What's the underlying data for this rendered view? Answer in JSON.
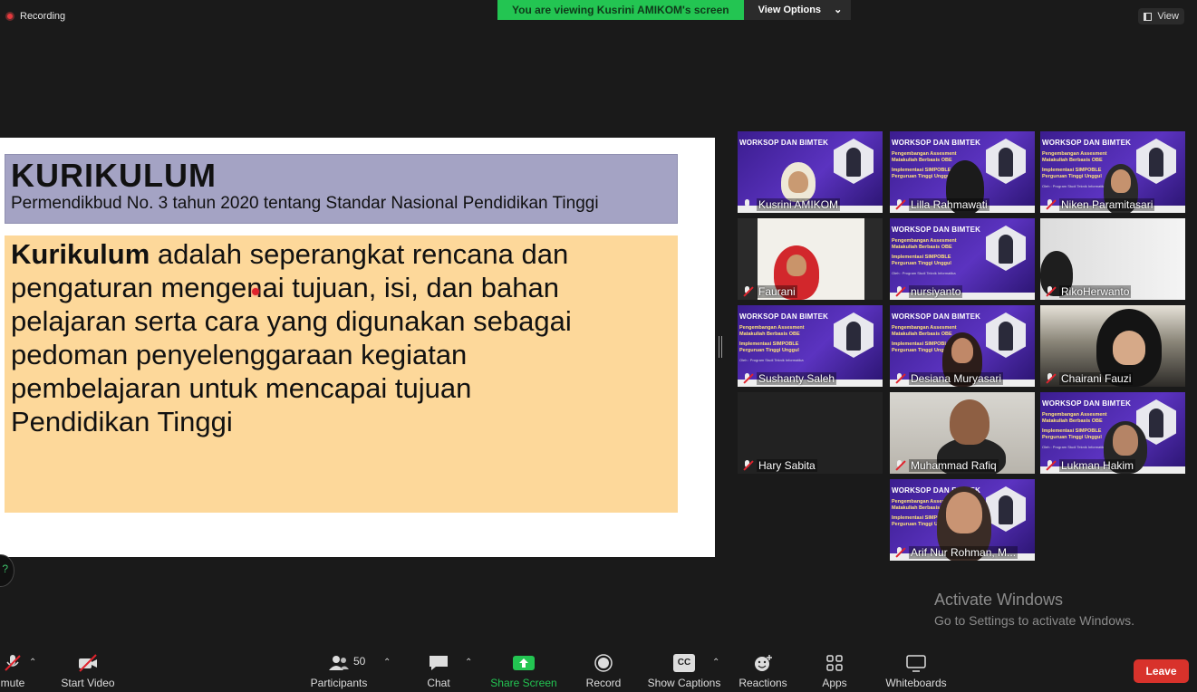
{
  "top": {
    "recording": "Recording",
    "banner": "You are viewing Kusrini AMIKOM's screen",
    "view_options": "View Options",
    "view": "View"
  },
  "slide": {
    "title": "KURIKULUM",
    "subtitle": "Permendikbud No. 3 tahun 2020 tentang Standar Nasional Pendidikan Tinggi",
    "body_bold": "Kurikulum",
    "body_lines": [
      " adalah seperangkat rencana dan",
      "pengaturan mengenai tujuan, isi, dan bahan",
      "pelajaran serta cara yang digunakan sebagai",
      "pedoman penyelenggaraan kegiatan",
      "pembelajaran untuk mencapai tujuan",
      "Pendidikan Tinggi"
    ]
  },
  "poster": {
    "line1": "WORKSOP DAN BIMTEK",
    "line2a": "Pengembangan Assesment",
    "line2b": "Matakuliah Berbasis OBE",
    "line3a": "Implementasi SIMPOBLE",
    "line3b": "Perguruan Tinggi Unggul",
    "line4": "Oleh : Program Studi Teknik Informatika"
  },
  "participants": [
    "Kusrini AMIKOM",
    "Lilla Rahmawati",
    "Niken Paramitasari",
    "Faurani",
    "nursiyanto",
    "RikoHerwanto",
    "Sushanty Saleh",
    "Desiana Muryasari",
    "Chairani Fauzi",
    "Hary Sabita",
    "Muhammad Rafiq",
    "Lukman Hakim",
    "Arif Nur Rohman, M..."
  ],
  "watermark": {
    "line1": "Activate Windows",
    "line2": "Go to Settings to activate Windows."
  },
  "toolbar": {
    "mute": "mute",
    "start_video": "Start Video",
    "participants": "Participants",
    "participants_count": "50",
    "chat": "Chat",
    "share_screen": "Share Screen",
    "record": "Record",
    "show_captions": "Show Captions",
    "cc": "CC",
    "reactions": "Reactions",
    "apps": "Apps",
    "whiteboards": "Whiteboards",
    "leave": "Leave"
  },
  "colors": {
    "banner_green": "#23c552",
    "active_speaker": "#d8f079",
    "leave_red": "#d8322b",
    "share_green": "#23c552"
  }
}
